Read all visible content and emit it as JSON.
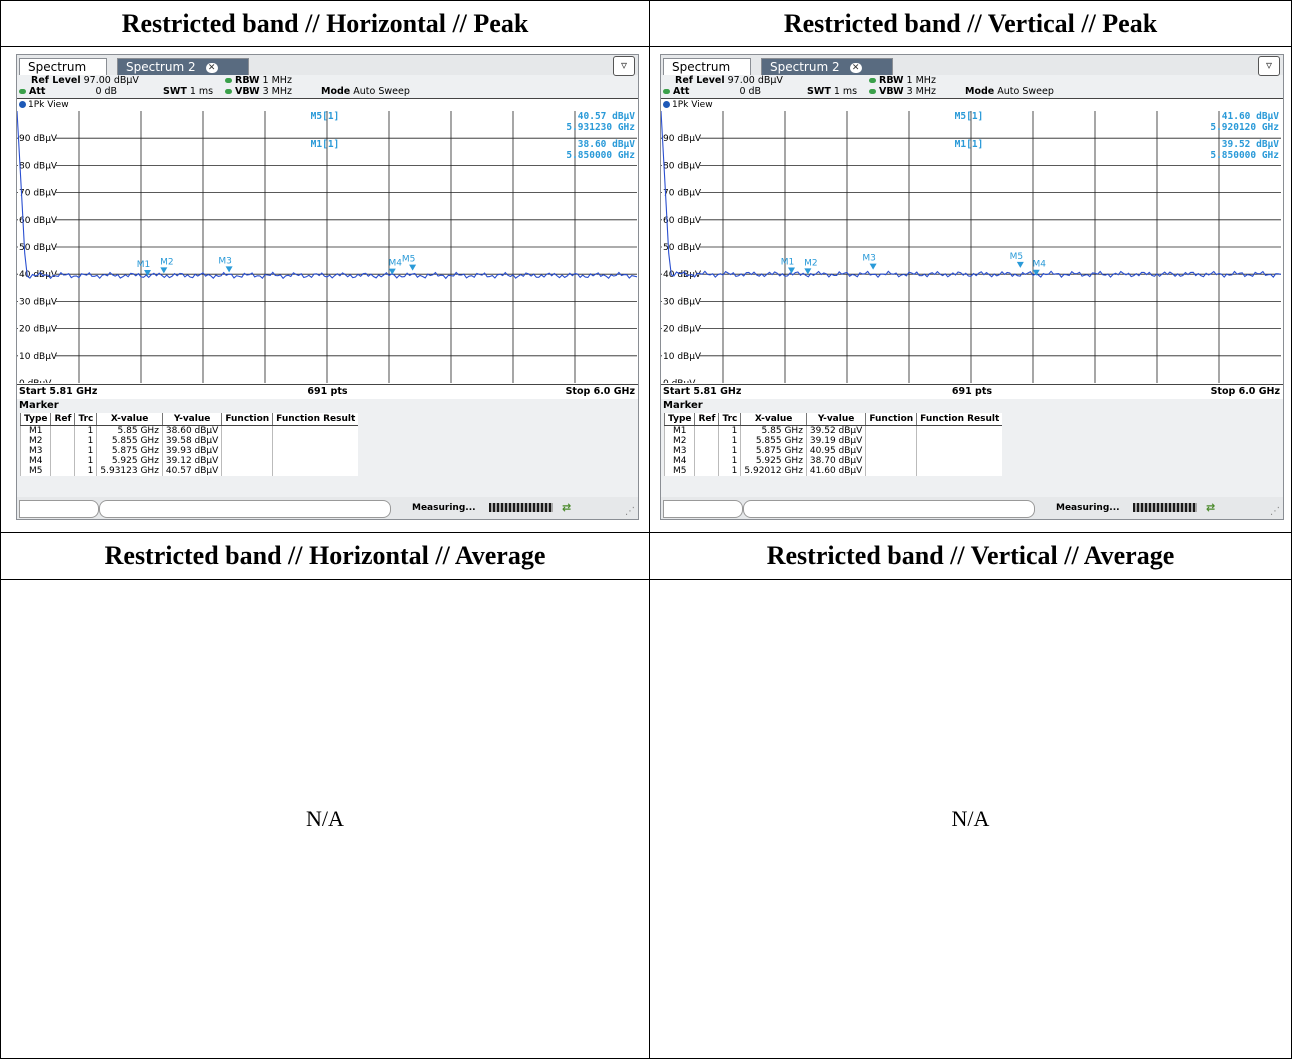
{
  "table": {
    "headers": [
      "Restricted band // Horizontal // Peak",
      "Restricted band // Vertical // Peak",
      "Restricted band // Horizontal // Average",
      "Restricted band // Vertical // Average"
    ],
    "na_text": "N/A"
  },
  "colors": {
    "trace": "#2a4fd0",
    "marker": "#2a9ad8",
    "grid": "#000000"
  },
  "screens": [
    {
      "tab_active": "Spectrum",
      "tab_inactive": "Spectrum 2",
      "ref_level_label": "Ref Level",
      "ref_level_value": "97.00 dBµV",
      "att_label": "Att",
      "att_value": "0 dB",
      "swt_label": "SWT",
      "swt_value": "1 ms",
      "rbw_label": "RBW",
      "rbw_value": "1 MHz",
      "vbw_label": "VBW",
      "vbw_value": "3 MHz",
      "mode_label": "Mode",
      "mode_value": "Auto Sweep",
      "view_label": "1Pk View",
      "y_ticks": [
        "90 dBµV",
        "80 dBµV",
        "70 dBµV",
        "60 dBµV",
        "50 dBµV",
        "40 dBµV",
        "30 dBµV",
        "20 dBµV",
        "10 dBµV",
        "0 dBµV"
      ],
      "readouts": [
        {
          "name": "M5[1]",
          "value": "40.57 dBµV",
          "freq": "5.931230 GHz"
        },
        {
          "name": "M1[1]",
          "value": "38.60 dBµV",
          "freq": "5.850000 GHz"
        }
      ],
      "start": "Start 5.81 GHz",
      "pts": "691 pts",
      "stop": "Stop 6.0 GHz",
      "marker_title": "Marker",
      "marker_headers": [
        "Type",
        "Ref",
        "Trc",
        "X-value",
        "Y-value",
        "Function",
        "Function Result"
      ],
      "marker_rows": [
        {
          "type": "M1",
          "ref": "",
          "trc": "1",
          "x": "5.85 GHz",
          "y": "38.60 dBµV"
        },
        {
          "type": "M2",
          "ref": "",
          "trc": "1",
          "x": "5.855 GHz",
          "y": "39.58 dBµV"
        },
        {
          "type": "M3",
          "ref": "",
          "trc": "1",
          "x": "5.875 GHz",
          "y": "39.93 dBµV"
        },
        {
          "type": "M4",
          "ref": "",
          "trc": "1",
          "x": "5.925 GHz",
          "y": "39.12 dBµV"
        },
        {
          "type": "M5",
          "ref": "",
          "trc": "1",
          "x": "5.93123 GHz",
          "y": "40.57 dBµV"
        }
      ],
      "markers_plot": [
        {
          "label": "M1",
          "f": 5.85,
          "v": 38.6
        },
        {
          "label": "M2",
          "f": 5.855,
          "v": 39.58
        },
        {
          "label": "M3",
          "f": 5.875,
          "v": 39.93
        },
        {
          "label": "M4",
          "f": 5.925,
          "v": 39.12
        },
        {
          "label": "M5",
          "f": 5.93123,
          "v": 40.57
        }
      ],
      "status_text": "Measuring..."
    },
    {
      "tab_active": "Spectrum",
      "tab_inactive": "Spectrum 2",
      "ref_level_label": "Ref Level",
      "ref_level_value": "97.00 dBµV",
      "att_label": "Att",
      "att_value": "0 dB",
      "swt_label": "SWT",
      "swt_value": "1 ms",
      "rbw_label": "RBW",
      "rbw_value": "1 MHz",
      "vbw_label": "VBW",
      "vbw_value": "3 MHz",
      "mode_label": "Mode",
      "mode_value": "Auto Sweep",
      "view_label": "1Pk View",
      "y_ticks": [
        "90 dBµV",
        "80 dBµV",
        "70 dBµV",
        "60 dBµV",
        "50 dBµV",
        "40 dBµV",
        "30 dBµV",
        "20 dBµV",
        "10 dBµV",
        "0 dBµV"
      ],
      "readouts": [
        {
          "name": "M5[1]",
          "value": "41.60 dBµV",
          "freq": "5.920120 GHz"
        },
        {
          "name": "M1[1]",
          "value": "39.52 dBµV",
          "freq": "5.850000 GHz"
        }
      ],
      "start": "Start 5.81 GHz",
      "pts": "691 pts",
      "stop": "Stop 6.0 GHz",
      "marker_title": "Marker",
      "marker_headers": [
        "Type",
        "Ref",
        "Trc",
        "X-value",
        "Y-value",
        "Function",
        "Function Result"
      ],
      "marker_rows": [
        {
          "type": "M1",
          "ref": "",
          "trc": "1",
          "x": "5.85 GHz",
          "y": "39.52 dBµV"
        },
        {
          "type": "M2",
          "ref": "",
          "trc": "1",
          "x": "5.855 GHz",
          "y": "39.19 dBµV"
        },
        {
          "type": "M3",
          "ref": "",
          "trc": "1",
          "x": "5.875 GHz",
          "y": "40.95 dBµV"
        },
        {
          "type": "M4",
          "ref": "",
          "trc": "1",
          "x": "5.925 GHz",
          "y": "38.70 dBµV"
        },
        {
          "type": "M5",
          "ref": "",
          "trc": "1",
          "x": "5.92012 GHz",
          "y": "41.60 dBµV"
        }
      ],
      "markers_plot": [
        {
          "label": "M1",
          "f": 5.85,
          "v": 39.52
        },
        {
          "label": "M2",
          "f": 5.855,
          "v": 39.19
        },
        {
          "label": "M3",
          "f": 5.875,
          "v": 40.95
        },
        {
          "label": "M4",
          "f": 5.925,
          "v": 38.7
        },
        {
          "label": "M5",
          "f": 5.92012,
          "v": 41.6
        }
      ],
      "status_text": "Measuring..."
    }
  ],
  "chart_data": [
    {
      "type": "line",
      "x_range": [
        5.81,
        6.0
      ],
      "ylim": [
        0,
        100
      ],
      "series": [],
      "markers": [
        {
          "label": "M1",
          "x": 5.85,
          "y": 38.6
        },
        {
          "label": "M2",
          "x": 5.855,
          "y": 39.58
        },
        {
          "label": "M3",
          "x": 5.875,
          "y": 39.93
        },
        {
          "label": "M4",
          "x": 5.925,
          "y": 39.12
        },
        {
          "label": "M5",
          "x": 5.93123,
          "y": 40.57
        }
      ],
      "grid": true
    },
    {
      "type": "line",
      "x_range": [
        5.81,
        6.0
      ],
      "ylim": [
        0,
        100
      ],
      "series": [],
      "markers": [
        {
          "label": "M1",
          "x": 5.85,
          "y": 39.52
        },
        {
          "label": "M2",
          "x": 5.855,
          "y": 39.19
        },
        {
          "label": "M3",
          "x": 5.875,
          "y": 40.95
        },
        {
          "label": "M4",
          "x": 5.925,
          "y": 38.7
        },
        {
          "label": "M5",
          "x": 5.92012,
          "y": 41.6
        }
      ],
      "grid": true
    }
  ]
}
